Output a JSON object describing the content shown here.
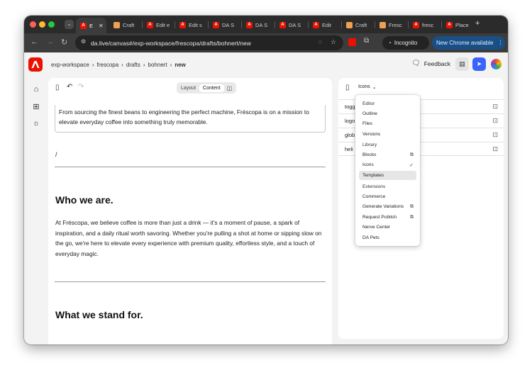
{
  "browser": {
    "tabs": [
      {
        "label": "E",
        "favicon": "adobe",
        "active": true
      },
      {
        "label": "Craft",
        "favicon": "craft"
      },
      {
        "label": "Edit e",
        "favicon": "adobe"
      },
      {
        "label": "Edit s",
        "favicon": "adobe"
      },
      {
        "label": "DA S",
        "favicon": "adobe"
      },
      {
        "label": "DA S",
        "favicon": "adobe"
      },
      {
        "label": "DA S",
        "favicon": "adobe"
      },
      {
        "label": "Edit",
        "favicon": "adobe"
      },
      {
        "label": "Craft",
        "favicon": "craft"
      },
      {
        "label": "Fresc",
        "favicon": "craft"
      },
      {
        "label": "fresc",
        "favicon": "adobe"
      },
      {
        "label": "Place",
        "favicon": "adobe"
      }
    ],
    "url": "da.live/canvas#/exp-workspace/frescopa/drafts/bohnert/new",
    "incognito_label": "Incognito",
    "update_label": "New Chrome available"
  },
  "app": {
    "breadcrumb": [
      "exp-workspace",
      "frescopa",
      "drafts",
      "bohnert",
      "new"
    ],
    "feedback_label": "Feedback"
  },
  "editor": {
    "view_toggle": {
      "layout": "Layout",
      "content": "Content"
    },
    "intro_text": "From sourcing the finest beans to engineering the perfect machine, Fréscopa is on a mission to elevate everyday coffee into something truly memorable.",
    "slash": "/",
    "heading_1": "Who we are.",
    "paragraph_1": "At Fréscopa, we believe coffee is more than just a drink — it's a moment of pause, a spark of inspiration, and a daily ritual worth savoring. Whether you're pulling a shot at home or sipping slow on the go, we're here to elevate every experience with premium quality, effortless style, and a touch of everyday magic.",
    "heading_2": "What we stand for."
  },
  "panel": {
    "selector_label": "Icons",
    "rows": [
      "togg",
      "logo",
      "glob",
      "heli"
    ]
  },
  "menu": {
    "sections": [
      {
        "header": "Editor",
        "items": [
          "Outline",
          "Files",
          "Versions"
        ]
      },
      {
        "header": "Library",
        "items": [
          "Blocks",
          "Icons",
          "Templates"
        ]
      },
      {
        "header": "Extensions",
        "items": [
          "Commerce",
          "Generate Variations",
          "Request Publish",
          "Nerve Center",
          "DA Pets"
        ]
      }
    ],
    "selected": "Templates",
    "checked": "Icons"
  }
}
